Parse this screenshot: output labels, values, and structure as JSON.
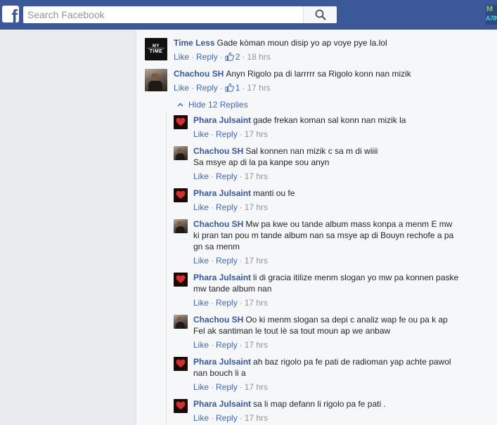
{
  "header": {
    "logo": "f",
    "search_placeholder": "Search Facebook",
    "corner_badge_top": "M",
    "corner_badge_bottom": "A7IN"
  },
  "actions": {
    "like": "Like",
    "reply": "Reply"
  },
  "comments": [
    {
      "author": "Time Less",
      "text": "Gade kòman moun disip yo ap voye pye la.lol",
      "like_count": "2",
      "time": "18 hrs",
      "avatar_text_1": "MY",
      "avatar_text_2": "TIME"
    },
    {
      "author": "Chachou SH",
      "text": "Anyn Rigolo pa di larrrrr sa Rigolo konn nan mizik",
      "like_count": "1",
      "time": "17 hrs"
    }
  ],
  "replies_toggle": "Hide 12 Replies",
  "replies": [
    {
      "author": "Phara Julsaint",
      "lines": [
        "gade frekan koman sal konn nan mizik la"
      ],
      "time": "17 hrs"
    },
    {
      "author": "Chachou SH",
      "lines": [
        "Sal konnen nan mizik c sa m di wiiii",
        "Sa msye ap di la pa kanpe sou anyn"
      ],
      "time": "17 hrs"
    },
    {
      "author": "Phara Julsaint",
      "lines": [
        "manti ou fe"
      ],
      "time": "17 hrs"
    },
    {
      "author": "Chachou SH",
      "lines": [
        "Mw pa kwe ou tande album mass konpa a menm E mw",
        "ki pran tan pou m tande album nan sa msye ap di Bouyn rechofe a pa",
        "gn sa menm"
      ],
      "time": "17 hrs"
    },
    {
      "author": "Phara Julsaint",
      "lines": [
        "li di gracia itilize menm slogan yo mw pa konnen paske",
        "mw tande album nan"
      ],
      "time": "17 hrs"
    },
    {
      "author": "Chachou SH",
      "lines": [
        "Oo ki menm slogan sa depi c analiz wap fe ou pa k ap",
        "Fel ak santiman le tout lè sa tout moun ap we anbaw"
      ],
      "time": "17 hrs"
    },
    {
      "author": "Phara Julsaint",
      "lines": [
        "ah baz rigolo pa fe pati de radioman yap achte pawol",
        "nan bouch li a"
      ],
      "time": "17 hrs"
    },
    {
      "author": "Phara Julsaint",
      "lines": [
        "sa li map defann li rigolo pa fe pati ."
      ],
      "time": "17 hrs"
    }
  ]
}
